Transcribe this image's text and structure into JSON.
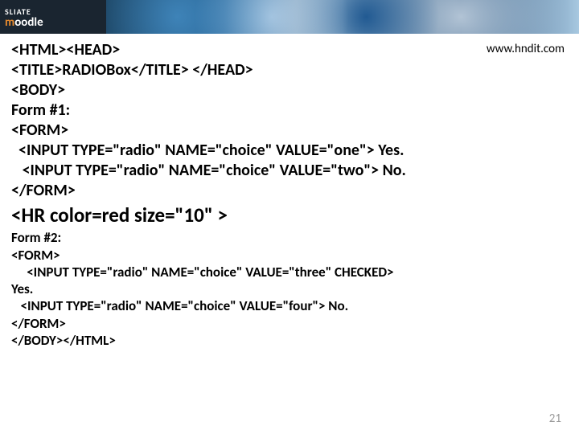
{
  "header": {
    "logo_line1": "SLIATE",
    "logo_line2_a": "m",
    "logo_line2_b": "oodle"
  },
  "url": "www.hndit.com",
  "code": {
    "l1": "<HTML><HEAD>",
    "l2": "<TITLE>RADIOBox</TITLE> </HEAD>",
    "l3": "<BODY>",
    "l4": "Form #1:",
    "l5": "<FORM>",
    "l6": "  <INPUT TYPE=\"radio\" NAME=\"choice\" VALUE=\"one\"> Yes.",
    "l7": "   <INPUT TYPE=\"radio\" NAME=\"choice\" VALUE=\"two\"> No.",
    "l8": "</FORM>",
    "hr": "<HR color=red size=\"10\" >",
    "l9": "Form #2:",
    "l10": "<FORM>",
    "l11": "     <INPUT TYPE=\"radio\" NAME=\"choice\" VALUE=\"three\" CHECKED>",
    "l12": "Yes.",
    "l13": "   <INPUT TYPE=\"radio\" NAME=\"choice\" VALUE=\"four\"> No.",
    "l14": "</FORM>",
    "l15": "</BODY></HTML>"
  },
  "page_number": "21"
}
